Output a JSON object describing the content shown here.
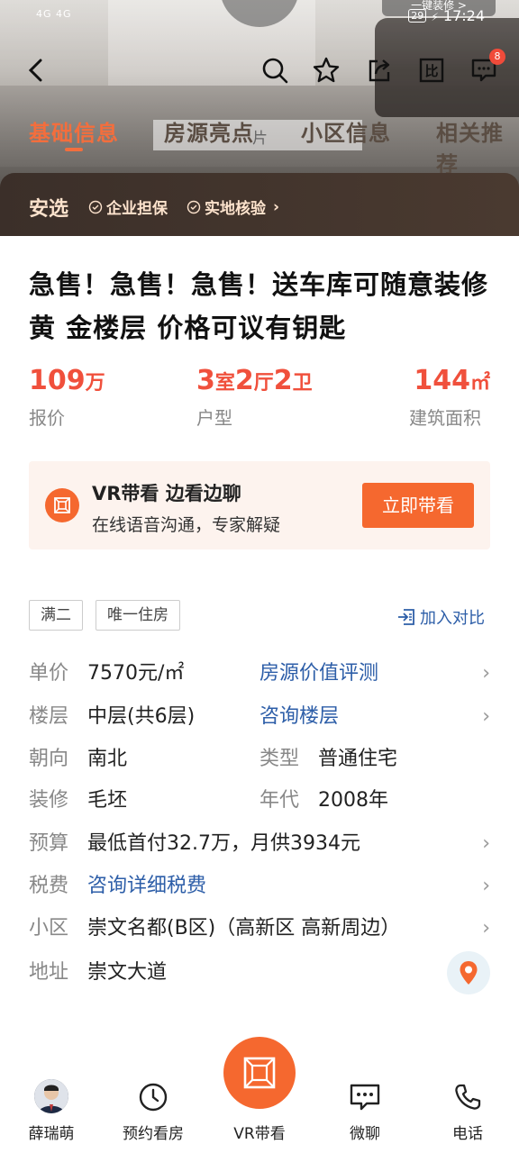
{
  "status_bar": {
    "signal": "4G 4G",
    "battery": "29",
    "time": "17:24"
  },
  "hero": {
    "top_pill": "一键装修 >",
    "photo_tab_hint": "片"
  },
  "nav": {
    "badge_count": "8"
  },
  "tabs": [
    "基础信息",
    "房源亮点",
    "小区信息",
    "相关推荐"
  ],
  "anxuan": {
    "title": "安选",
    "items": [
      "企业担保",
      "实地核验"
    ]
  },
  "title": "急售！急售！急售！送车库可随意装修黄 金楼层 价格可议有钥匙",
  "key_info": [
    {
      "value": "109",
      "unit": "万",
      "label": "报价"
    },
    {
      "value_parts": [
        "3",
        "室",
        "2",
        "厅",
        "2",
        "卫"
      ],
      "label": "户型"
    },
    {
      "value": "144",
      "unit": "㎡",
      "label": "建筑面积"
    }
  ],
  "vr_card": {
    "title": "VR带看 边看边聊",
    "subtitle": "在线语音沟通，专家解疑",
    "button": "立即带看"
  },
  "tags": [
    "满二",
    "唯一住房"
  ],
  "compare_label": "加入对比",
  "details": {
    "unit_price": {
      "label": "单价",
      "value": "7570元/㎡",
      "link": "房源价值评测"
    },
    "floor": {
      "label": "楼层",
      "value": "中层(共6层)",
      "link": "咨询楼层"
    },
    "orientation": {
      "label": "朝向",
      "value": "南北",
      "label2": "类型",
      "value2": "普通住宅"
    },
    "decoration": {
      "label": "装修",
      "value": "毛坯",
      "label2": "年代",
      "value2": "2008年"
    },
    "budget": {
      "label": "预算",
      "value": "最低首付32.7万，月供3934元"
    },
    "tax": {
      "label": "税费",
      "value": "咨询详细税费"
    },
    "community": {
      "label": "小区",
      "value": "崇文名都(B区)（高新区 高新周边）"
    },
    "address": {
      "label": "地址",
      "value": "崇文大道"
    }
  },
  "bottom_bar": {
    "agent": "薛瑞萌",
    "schedule": "预约看房",
    "vr": "VR带看",
    "chat": "微聊",
    "phone": "电话"
  },
  "colors": {
    "accent": "#f5682f",
    "price_red": "#f0503c",
    "link_blue": "#2d5ea8",
    "anxuan_bg": "#3b2f29"
  }
}
